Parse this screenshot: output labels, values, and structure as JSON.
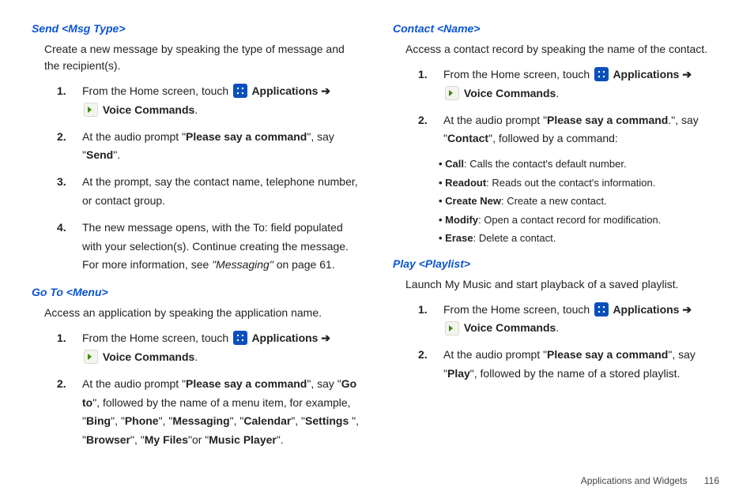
{
  "left": {
    "send": {
      "title": "Send <Msg Type>",
      "lead": "Create a new message by speaking the type of message and the recipient(s).",
      "steps": {
        "s1a": "From the Home screen, touch ",
        "s1_apps": " Applications ➔",
        "s1b": " Voice Commands",
        "s1c": ".",
        "s2a": "At the audio prompt \"",
        "s2_psc": "Please say a command",
        "s2b": "\", say  \"",
        "s2_send": "Send",
        "s2c": "\".",
        "s3": "At the prompt, say the contact name, telephone number, or contact group.",
        "s4a": "The new message opens, with the To: field populated with your selection(s). Continue creating the message. For more information, see ",
        "s4_ref": "\"Messaging\"",
        "s4b": " on page 61."
      }
    },
    "goto": {
      "title": "Go To <Menu>",
      "lead": "Access an application by speaking the application name.",
      "steps": {
        "s1a": "From the Home screen, touch ",
        "s1_apps": " Applications ➔",
        "s1b": " Voice Commands",
        "s1c": ".",
        "s2a": "At the audio prompt \"",
        "s2_psc": "Please say a command",
        "s2b": "\", say \"",
        "s2_goto": "Go to",
        "s2c": "\", followed by the name of a menu item, for example, \"",
        "s2_bing": "Bing",
        "s2d": "\", \"",
        "s2_phone": "Phone",
        "s2e": "\", \"",
        "s2_msg": "Messaging",
        "s2f": "\", \"",
        "s2_cal": "Calendar",
        "s2g": "\", \"",
        "s2_set": "Settings ",
        "s2h": "\", \"",
        "s2_brw": "Browser",
        "s2i": "\", \"",
        "s2_mf": "My Files",
        "s2j": "\"or \"",
        "s2_mp": "Music Player",
        "s2k": "\"."
      }
    }
  },
  "right": {
    "contact": {
      "title": "Contact <Name>",
      "lead": "Access a contact record by speaking the name of the contact.",
      "steps": {
        "s1a": "From the Home screen, touch ",
        "s1_apps": " Applications ➔",
        "s1b": " Voice Commands",
        "s1c": ".",
        "s2a": "At the audio prompt \"",
        "s2_psc": "Please say a command",
        "s2b": ".\", say \"",
        "s2_contact": "Contact",
        "s2c": "\", followed by a command:"
      },
      "sub": {
        "call_b": "Call",
        "call_t": ": Calls the contact's default number.",
        "read_b": "Readout",
        "read_t": ": Reads out the contact's information.",
        "new_b": "Create New",
        "new_t": ": Create a new contact.",
        "mod_b": "Modify",
        "mod_t": ": Open a contact record for modification.",
        "erase_b": "Erase",
        "erase_t": ": Delete a contact."
      }
    },
    "play": {
      "title": "Play <Playlist>",
      "lead": "Launch My Music and start playback of a saved playlist.",
      "steps": {
        "s1a": "From the Home screen, touch ",
        "s1_apps": " Applications ➔",
        "s1b": " Voice Commands",
        "s1c": ".",
        "s2a": "At the audio prompt \"",
        "s2_psc": "Please say a command",
        "s2b": "\", say \"",
        "s2_play": "Play",
        "s2c": "\", followed by the name of a stored playlist."
      }
    }
  },
  "footer": {
    "section": "Applications and Widgets",
    "page": "116"
  }
}
